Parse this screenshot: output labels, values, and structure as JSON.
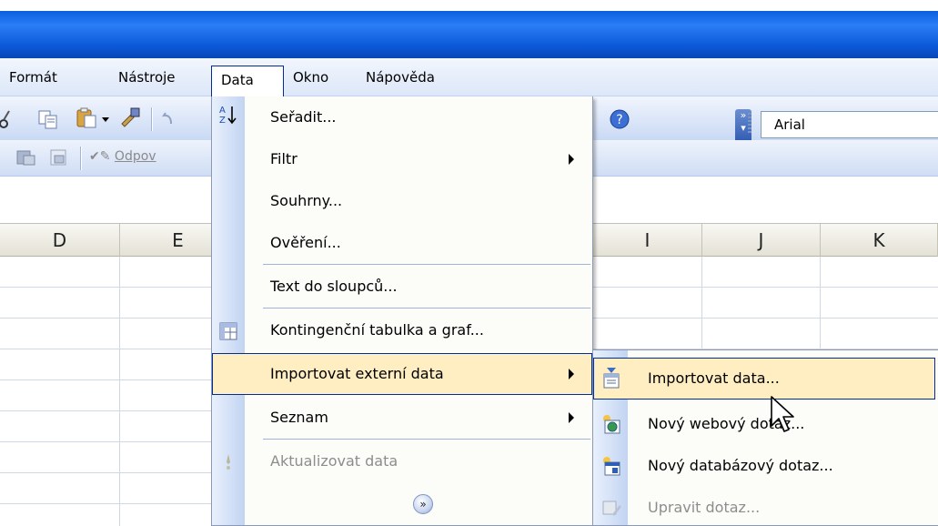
{
  "menubar": {
    "items": [
      "Formát",
      "Nástroje",
      "Data",
      "Okno",
      "Nápověda"
    ],
    "active": "Data"
  },
  "toolbar": {
    "font_name": "Arial",
    "odpov_label": "Odpov"
  },
  "columns": [
    "D",
    "E",
    "I",
    "J",
    "K"
  ],
  "data_menu": {
    "items": [
      {
        "label": "Seřadit...",
        "icon": "sort-az-icon"
      },
      {
        "label": "Filtr",
        "submenu": true
      },
      {
        "label": "Souhrny..."
      },
      {
        "label": "Ověření..."
      },
      {
        "label": "Text do sloupců..."
      },
      {
        "label": "Kontingenční tabulka a graf...",
        "icon": "pivot-table-icon"
      },
      {
        "label": "Importovat externí data",
        "submenu": true,
        "highlighted": true
      },
      {
        "label": "Seznam",
        "submenu": true
      },
      {
        "label": "Aktualizovat data",
        "icon": "refresh-icon",
        "disabled": true
      }
    ]
  },
  "import_submenu": {
    "items": [
      {
        "label": "Importovat data...",
        "icon": "import-data-icon",
        "highlighted": true
      },
      {
        "label": "Nový webový dotaz...",
        "icon": "web-query-icon"
      },
      {
        "label": "Nový databázový dotaz...",
        "icon": "database-query-icon"
      },
      {
        "label": "Upravit dotaz...",
        "icon": "edit-query-icon",
        "disabled": true
      }
    ]
  },
  "colors": {
    "titlebar": "#0a58d8",
    "highlight_bg": "#ffeec2",
    "highlight_border": "#002d96"
  }
}
